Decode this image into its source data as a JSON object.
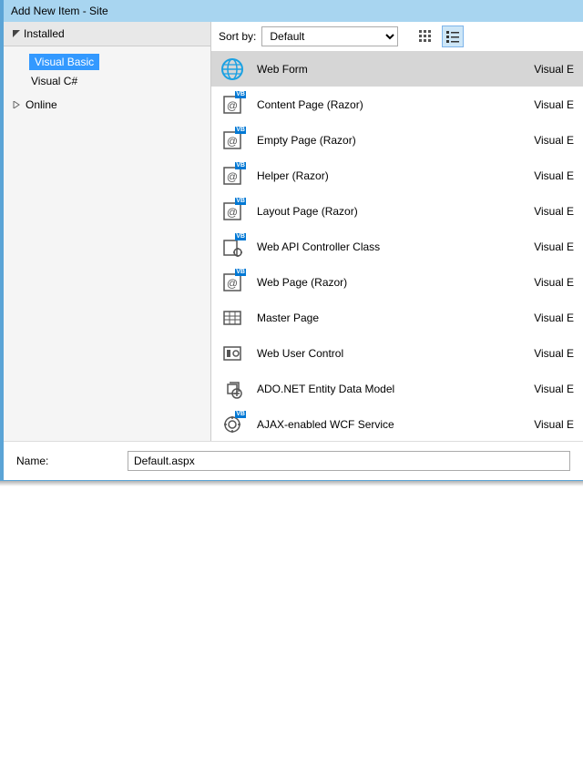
{
  "title": "Add New Item - Site",
  "sidebar": {
    "header": "Installed",
    "items": [
      {
        "label": "Visual Basic",
        "selected": true
      },
      {
        "label": "Visual C#",
        "selected": false
      }
    ],
    "node2": "Online"
  },
  "toolbar": {
    "sort_label": "Sort by:",
    "sort_value": "Default"
  },
  "items": [
    {
      "label": "Web Form",
      "lang": "Visual E",
      "icon": "globe",
      "selected": true
    },
    {
      "label": "Content Page (Razor)",
      "lang": "Visual E",
      "icon": "at-vb"
    },
    {
      "label": "Empty Page (Razor)",
      "lang": "Visual E",
      "icon": "at-vb"
    },
    {
      "label": "Helper (Razor)",
      "lang": "Visual E",
      "icon": "at-vb"
    },
    {
      "label": "Layout Page (Razor)",
      "lang": "Visual E",
      "icon": "at-vb"
    },
    {
      "label": "Web API Controller Class",
      "lang": "Visual E",
      "icon": "gear-vb"
    },
    {
      "label": "Web Page (Razor)",
      "lang": "Visual E",
      "icon": "at-vb"
    },
    {
      "label": "Master Page",
      "lang": "Visual E",
      "icon": "grid"
    },
    {
      "label": "Web User Control",
      "lang": "Visual E",
      "icon": "control"
    },
    {
      "label": "ADO.NET Entity Data Model",
      "lang": "Visual E",
      "icon": "entity"
    },
    {
      "label": "AJAX-enabled WCF Service",
      "lang": "Visual E",
      "icon": "ajax-vb"
    }
  ],
  "name_label": "Name:",
  "name_value": "Default.aspx"
}
